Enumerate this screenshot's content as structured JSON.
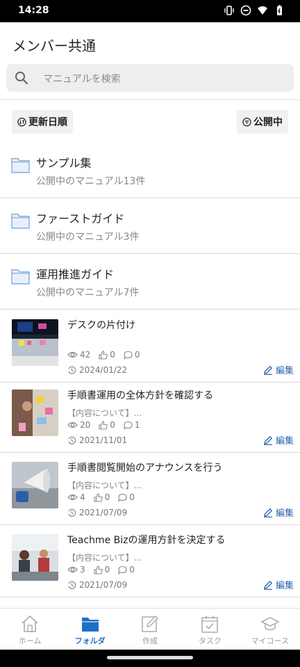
{
  "status_bar": {
    "time": "14:28"
  },
  "app": {
    "title": "メンバー共通"
  },
  "search": {
    "placeholder": "マニュアルを検索"
  },
  "filters": {
    "sort_label": "更新日順",
    "status_label": "公開中"
  },
  "folders": [
    {
      "name": "サンプル集",
      "count": "公開中のマニュアル13件"
    },
    {
      "name": "ファーストガイド",
      "count": "公開中のマニュアル3件"
    },
    {
      "name": "運用推進ガイド",
      "count": "公開中のマニュアル7件"
    }
  ],
  "manuals": [
    {
      "title": "デスクの片付け",
      "subtitle": "",
      "views": "42",
      "likes": "0",
      "comments": "0",
      "date": "2024/01/22",
      "edit": "編集"
    },
    {
      "title": "手順書運用の全体方針を確認する",
      "subtitle": "【内容について】...",
      "views": "20",
      "likes": "0",
      "comments": "1",
      "date": "2021/11/01",
      "edit": "編集"
    },
    {
      "title": "手順書閲覧開始のアナウンスを行う",
      "subtitle": "【内容について】...",
      "views": "4",
      "likes": "0",
      "comments": "0",
      "date": "2021/07/09",
      "edit": "編集"
    },
    {
      "title": "Teachme Bizの運用方針を決定する",
      "subtitle": "【内容について】...",
      "views": "3",
      "likes": "0",
      "comments": "0",
      "date": "2021/07/09",
      "edit": "編集"
    }
  ],
  "tabs": [
    {
      "label": "ホーム"
    },
    {
      "label": "フォルダ"
    },
    {
      "label": "作成"
    },
    {
      "label": "タスク"
    },
    {
      "label": "マイコース"
    }
  ],
  "colors": {
    "accent": "#1f6fc7",
    "edit": "#2d62b0"
  }
}
